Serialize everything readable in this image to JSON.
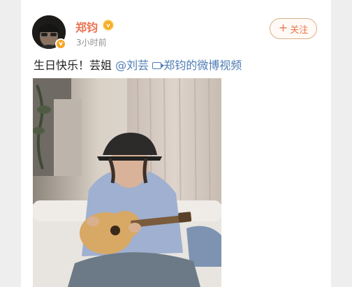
{
  "post": {
    "username": "郑钧",
    "timestamp": "3小时前",
    "follow_label": "关注",
    "follow_icon": "+",
    "text_main": "生日快乐！芸姐",
    "mention": "@刘芸",
    "video_link": "郑钧的微博视频"
  },
  "icons": {
    "verified": "verified-badge-icon",
    "vip": "vip-badge-icon",
    "video": "video-icon"
  },
  "colors": {
    "username": "#eb7350",
    "link": "#4f7cb4",
    "verified": "#f5a623"
  }
}
